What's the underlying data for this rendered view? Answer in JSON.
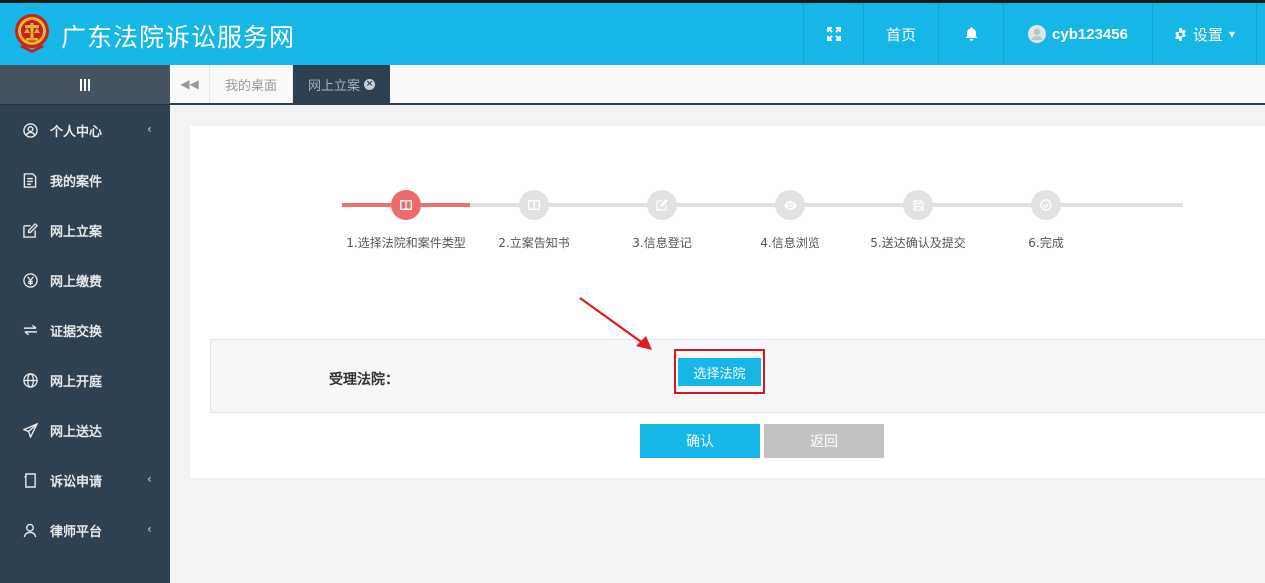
{
  "header": {
    "site_title": "广东法院诉讼服务网",
    "nav": {
      "home": "首页",
      "username": "cyb123456",
      "settings": "设置"
    }
  },
  "sidebar": {
    "items": [
      {
        "label": "个人中心",
        "icon": "user-circle-icon",
        "has_submenu": true
      },
      {
        "label": "我的案件",
        "icon": "document-icon",
        "has_submenu": false
      },
      {
        "label": "网上立案",
        "icon": "edit-icon",
        "has_submenu": false
      },
      {
        "label": "网上缴费",
        "icon": "yen-icon",
        "has_submenu": false
      },
      {
        "label": "证据交换",
        "icon": "exchange-icon",
        "has_submenu": false
      },
      {
        "label": "网上开庭",
        "icon": "globe-icon",
        "has_submenu": false
      },
      {
        "label": "网上送达",
        "icon": "send-icon",
        "has_submenu": false
      },
      {
        "label": "诉讼申请",
        "icon": "form-icon",
        "has_submenu": true
      },
      {
        "label": "律师平台",
        "icon": "person-icon",
        "has_submenu": true
      }
    ]
  },
  "tabs": [
    {
      "label": "我的桌面",
      "active": false
    },
    {
      "label": "网上立案",
      "active": true
    }
  ],
  "steps": [
    {
      "label": "1.选择法院和案件类型",
      "icon": "columns-icon",
      "active": true
    },
    {
      "label": "2.立案告知书",
      "icon": "columns-icon",
      "active": false
    },
    {
      "label": "3.信息登记",
      "icon": "edit-icon",
      "active": false
    },
    {
      "label": "4.信息浏览",
      "icon": "eye-icon",
      "active": false
    },
    {
      "label": "5.送达确认及提交",
      "icon": "save-icon",
      "active": false
    },
    {
      "label": "6.完成",
      "icon": "check-circle-icon",
      "active": false
    }
  ],
  "form": {
    "court_label": "受理法院：",
    "select_court_button": "选择法院",
    "confirm_button": "确认",
    "back_button": "返回"
  },
  "colors": {
    "header_bg": "#16b6e6",
    "sidebar_bg": "#2f4050",
    "step_active": "#ee6b6b",
    "highlight": "#d01a1a"
  }
}
